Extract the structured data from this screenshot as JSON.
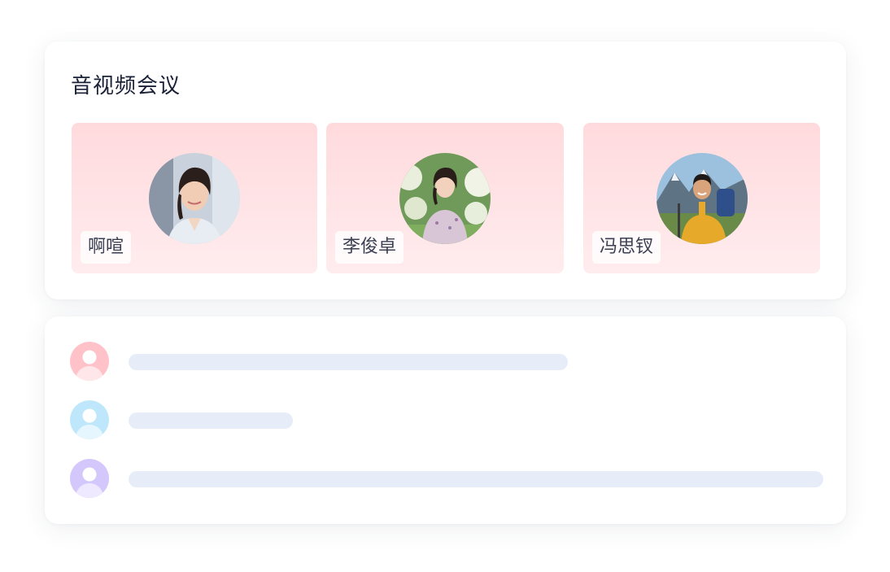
{
  "meeting": {
    "title": "音视频会议",
    "participants": [
      {
        "name": "啊喧",
        "photo": "portrait-woman-office-photo"
      },
      {
        "name": "李俊卓",
        "photo": "portrait-woman-garden-photo"
      },
      {
        "name": "冯思钗",
        "photo": "portrait-man-hiker-photo"
      }
    ]
  },
  "chat_list": {
    "items": [
      {
        "icon": "user-icon",
        "color": "#ffc2c8",
        "line_fraction": 0.63
      },
      {
        "icon": "user-icon",
        "color": "#bfe7fb",
        "line_fraction": 0.24
      },
      {
        "icon": "user-icon",
        "color": "#d3c7fb",
        "line_fraction": 1.0
      }
    ]
  },
  "colors": {
    "tile_bg": "#ffdadd",
    "placeholder_bar": "#e6ecf8",
    "title": "#1b2238"
  }
}
